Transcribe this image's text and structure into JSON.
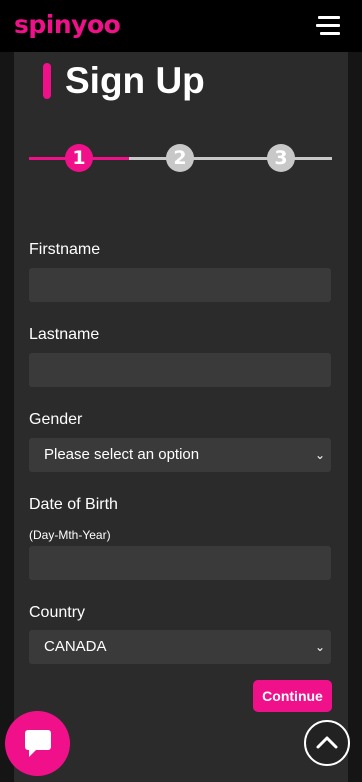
{
  "header": {
    "logo_text": "spinyoo",
    "menu_icon": "hamburger-menu-icon"
  },
  "page": {
    "title": "Sign Up"
  },
  "steps": [
    {
      "number": "1",
      "state": "active"
    },
    {
      "number": "2",
      "state": "inactive"
    },
    {
      "number": "3",
      "state": "inactive"
    }
  ],
  "form": {
    "firstname_label": "Firstname",
    "firstname_value": "",
    "lastname_label": "Lastname",
    "lastname_value": "",
    "gender_label": "Gender",
    "gender_value": "Please select an option",
    "dob_label": "Date of Birth",
    "dob_hint": "(Day-Mth-Year)",
    "dob_value": "",
    "country_label": "Country",
    "country_value": "CANADA",
    "continue_label": "Continue"
  },
  "colors": {
    "accent": "#f0118a",
    "panel": "#2b2b2b",
    "field": "#3a3a3a"
  },
  "floating": {
    "chat_icon": "chat-bubble-icon",
    "scroll_icon": "chevron-up-icon"
  }
}
